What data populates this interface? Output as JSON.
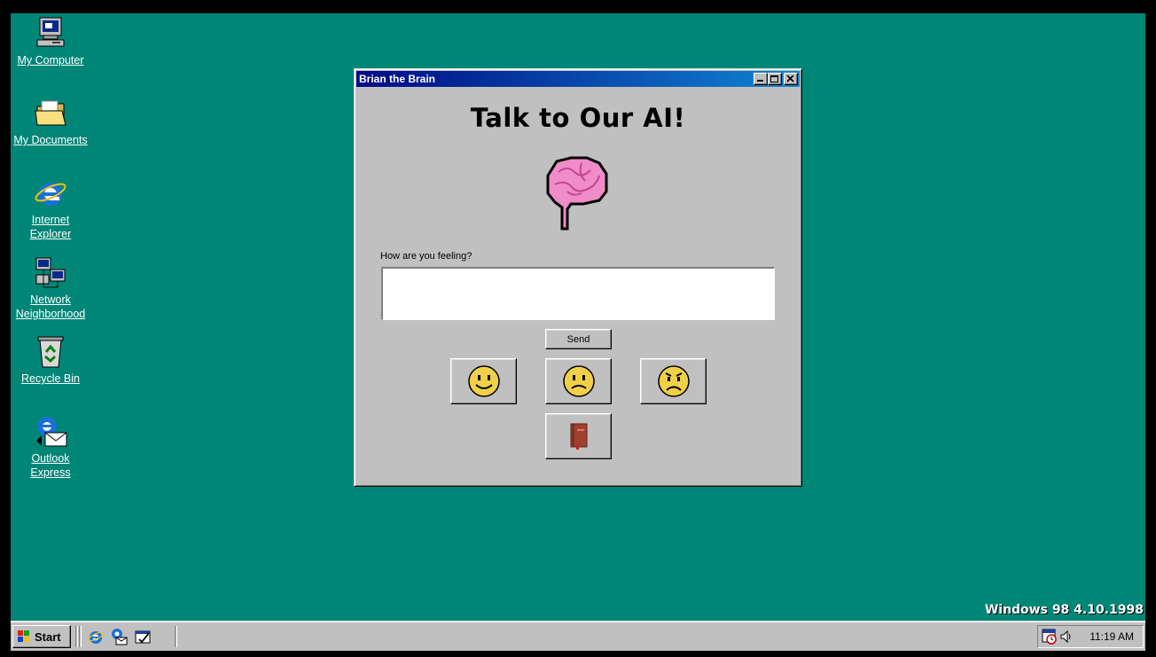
{
  "desktop": {
    "background": "#008677",
    "icons": [
      {
        "label": "My Computer",
        "icon": "computer-icon"
      },
      {
        "label": "My Documents",
        "icon": "folder-icon"
      },
      {
        "label": "Internet Explorer",
        "icon": "internet-explorer-icon"
      },
      {
        "label": "Network Neighborhood",
        "icon": "network-icon"
      },
      {
        "label": "Recycle Bin",
        "icon": "recycle-bin-icon"
      },
      {
        "label": "Outlook Express",
        "icon": "outlook-express-icon"
      }
    ],
    "version_text": "Windows 98 4.10.1998"
  },
  "window": {
    "title": "Brian the Brain",
    "heading": "Talk to Our AI!",
    "brain_icon": "brain-icon",
    "prompt_label": "How are you feeling?",
    "input_value": "",
    "send_label": "Send",
    "mood_buttons": [
      "happy-face-icon",
      "neutral-face-icon",
      "sad-face-icon"
    ],
    "journal_icon": "book-icon"
  },
  "taskbar": {
    "start_label": "Start",
    "clock": "11:19 AM"
  }
}
